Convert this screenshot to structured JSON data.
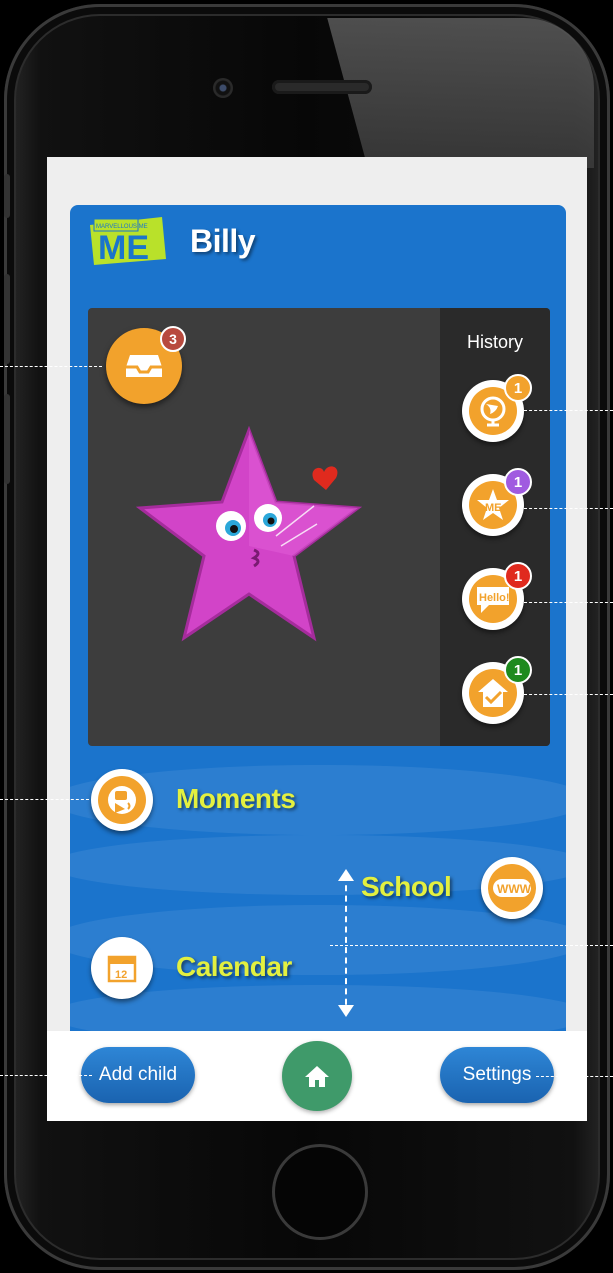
{
  "app": {
    "logo_text": "MARVELLOUS ME",
    "child_name": "Billy",
    "inbox_badge": "3",
    "history": {
      "label": "History",
      "items": [
        {
          "name": "globe",
          "badge": "1",
          "badge_color": "#f2a22c"
        },
        {
          "name": "me-star",
          "badge": "1",
          "badge_color": "#a05be0"
        },
        {
          "name": "hello",
          "badge": "1",
          "badge_color": "#e02a1e"
        },
        {
          "name": "homework",
          "badge": "1",
          "badge_color": "#1e8a1e"
        }
      ]
    },
    "menu": {
      "moments": "Moments",
      "school": "School",
      "calendar": "Calendar",
      "calendar_day": "12",
      "school_icon_text": "WWW"
    },
    "bottom_bar": {
      "add_child": "Add child",
      "settings": "Settings"
    },
    "colors": {
      "app_blue": "#1b74cc",
      "accent_orange": "#f2a22c",
      "menu_yellow": "#e3f040",
      "home_green": "#3f9a6a"
    }
  }
}
